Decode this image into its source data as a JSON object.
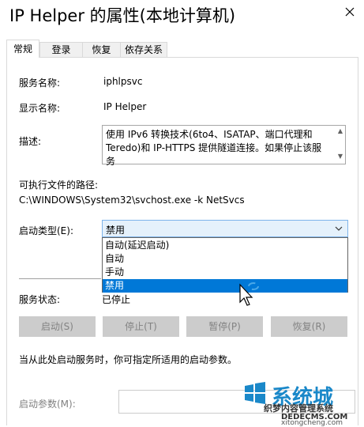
{
  "window": {
    "title": "IP Helper 的属性(本地计算机)"
  },
  "tabs": [
    {
      "label": "常规",
      "active": true
    },
    {
      "label": "登录",
      "active": false
    },
    {
      "label": "恢复",
      "active": false
    },
    {
      "label": "依存关系",
      "active": false
    }
  ],
  "general": {
    "service_name_label": "服务名称:",
    "service_name_value": "iphlpsvc",
    "display_name_label": "显示名称:",
    "display_name_value": "IP Helper",
    "description_label": "描述:",
    "description_value": "使用 IPv6 转换技术(6to4、ISATAP、端口代理和 Teredo)和 IP-HTTPS 提供隧道连接。如果停止该服务",
    "exe_path_label": "可执行文件的路径:",
    "exe_path_value": "C:\\WINDOWS\\System32\\svchost.exe -k NetSvcs",
    "startup_type_label": "启动类型(E):",
    "startup_type_value": "禁用",
    "startup_options": [
      "自动(延迟启动)",
      "自动",
      "手动",
      "禁用"
    ],
    "service_status_label": "服务状态:",
    "service_status_value": "已停止",
    "buttons": {
      "start": "启动(S)",
      "stop": "停止(T)",
      "pause": "暂停(P)",
      "resume": "恢复(R)"
    },
    "hint": "当从此处启动服务时，你可指定所适用的启动参数。",
    "start_params_label": "启动参数(M):"
  },
  "watermark": {
    "brand": "系统城",
    "sub": "织梦内容管理系统",
    "sub2": "DEDECMS.COM",
    "url": "xitongcheng.com"
  },
  "colors": {
    "selection": "#0078d7",
    "combo_bg": "#e5f1fb",
    "combo_border": "#7eb4ea",
    "disabled_button": "#cccccc",
    "watermark_blue": "#1a88c9"
  }
}
